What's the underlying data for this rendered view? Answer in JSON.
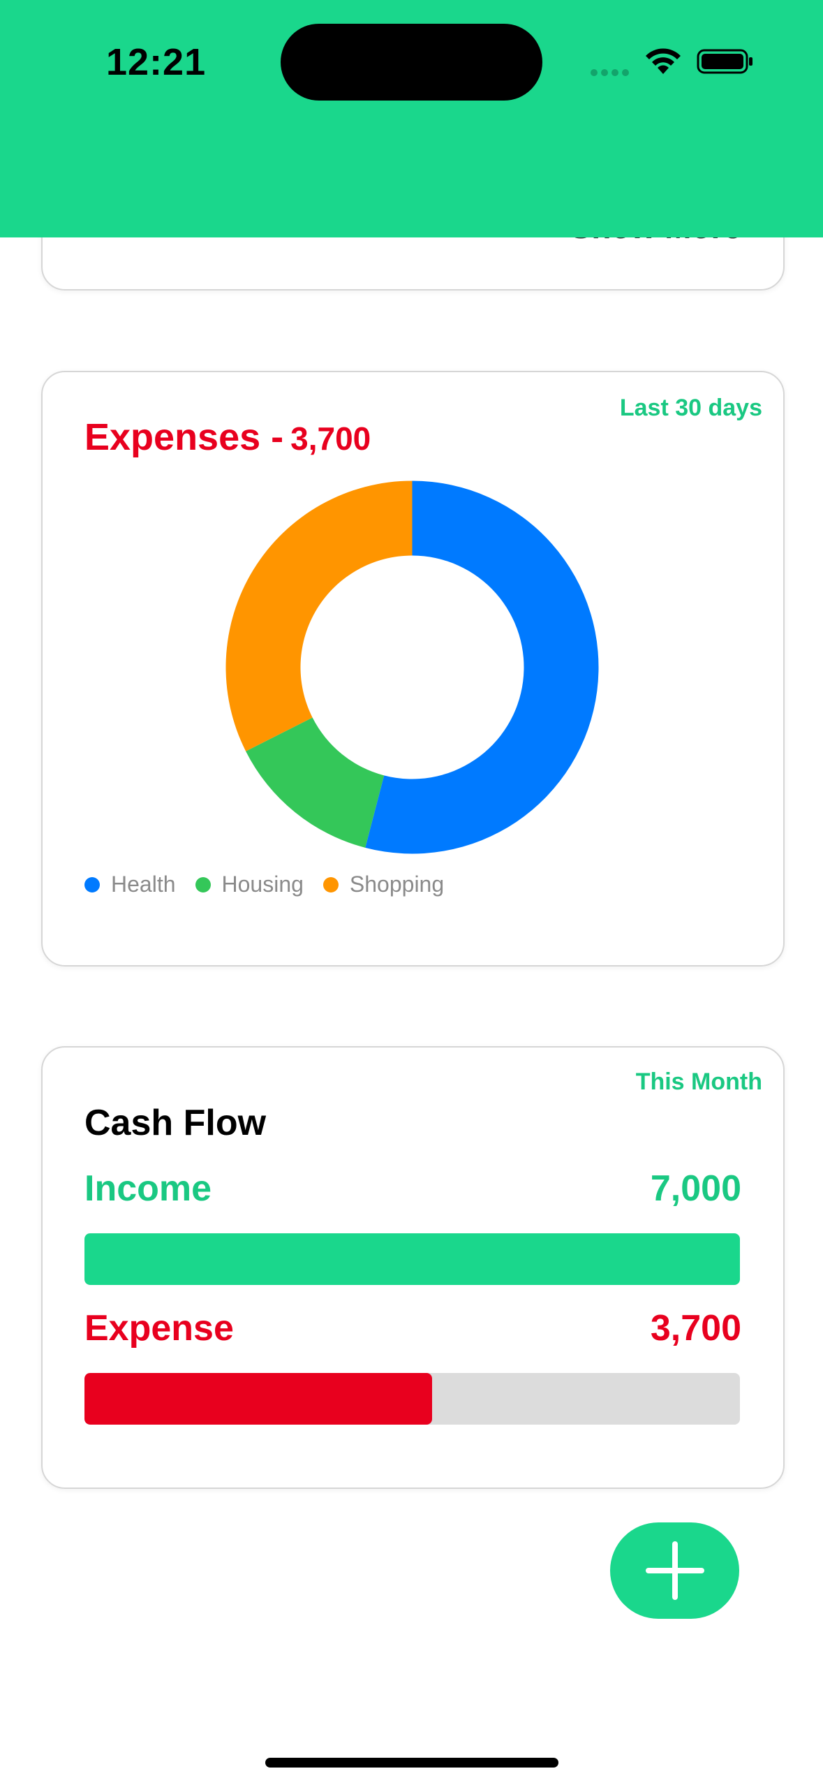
{
  "status_bar": {
    "time": "12:21"
  },
  "top_card": {
    "show_more_label": "Show More"
  },
  "expenses_card": {
    "period": "Last 30 days",
    "title_label": "Expenses -",
    "title_amount": "3,700",
    "chart_data": {
      "type": "pie",
      "style": "donut",
      "categories": [
        "Health",
        "Housing",
        "Shopping"
      ],
      "values": [
        2000,
        500,
        1200
      ],
      "colors": [
        "#007aff",
        "#34c759",
        "#ff9500"
      ],
      "legend_position": "bottom-left"
    }
  },
  "cashflow_card": {
    "period": "This Month",
    "title": "Cash Flow",
    "income": {
      "label": "Income",
      "value": "7,000",
      "fill_fraction": 1.0,
      "color": "#1ad78c"
    },
    "expense": {
      "label": "Expense",
      "value": "3,700",
      "fill_fraction": 0.53,
      "color": "#e8001e"
    }
  },
  "fab": {
    "icon": "plus-icon"
  },
  "colors": {
    "accent": "#1ad78c",
    "expense_red": "#e8001e"
  }
}
